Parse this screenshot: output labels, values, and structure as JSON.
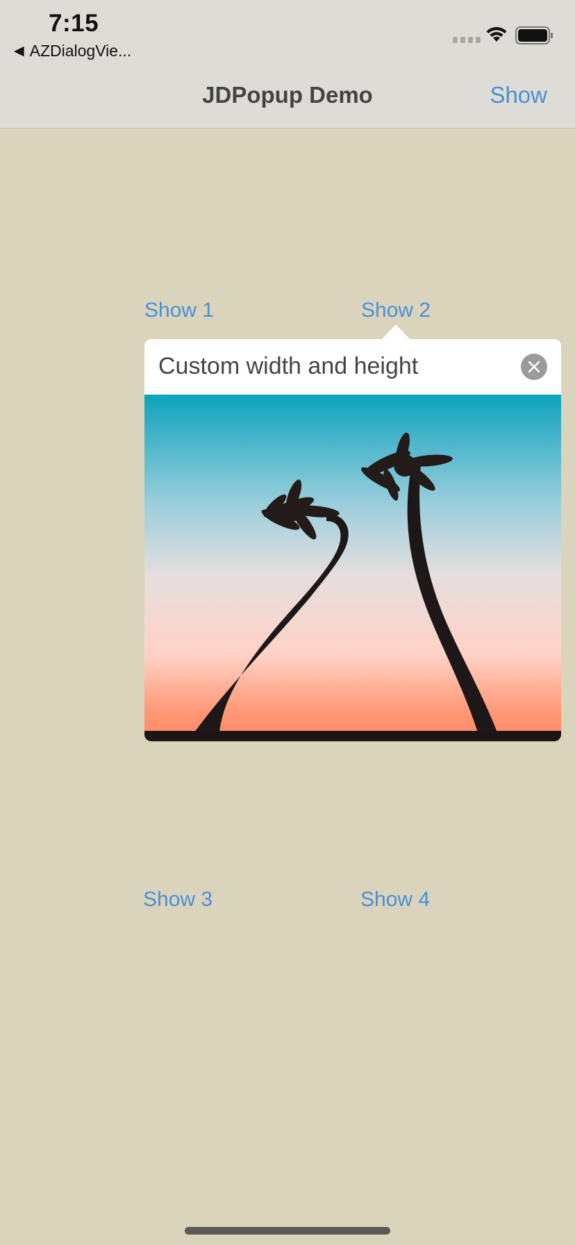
{
  "status_bar": {
    "time": "7:15",
    "back_app_label": "AZDialogVie...",
    "back_icon": "back-triangle-icon",
    "signal_icon": "cellular-signal-icon",
    "wifi_icon": "wifi-icon",
    "battery_icon": "battery-icon"
  },
  "nav": {
    "title": "JDPopup Demo",
    "right_button_label": "Show"
  },
  "buttons": {
    "show1": "Show 1",
    "show2": "Show 2",
    "show3": "Show 3",
    "show4": "Show 4"
  },
  "popup": {
    "title": "Custom width and height",
    "close_icon": "close-icon",
    "image": "palm-trees-sunset-photo"
  },
  "colors": {
    "background": "#dad4bc",
    "nav_bar": "#dedcd6",
    "accent": "#4a8fd8",
    "popup_bg": "#ffffff",
    "close_button": "#9b9b9b"
  }
}
